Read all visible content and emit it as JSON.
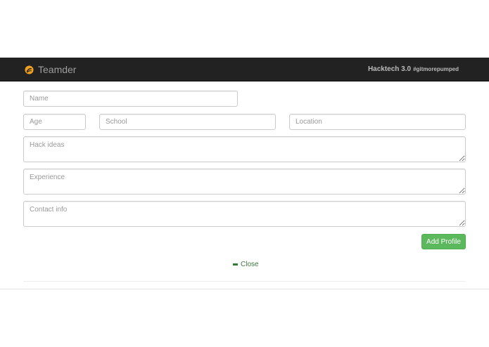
{
  "navbar": {
    "brand_label": "Teamder",
    "brand_icon": "flame-logo-icon",
    "event_title": "Hacktech 3.0",
    "event_hashtag": "#gitmorepumped"
  },
  "form": {
    "name_placeholder": "Name",
    "age_placeholder": "Age",
    "school_placeholder": "School",
    "location_placeholder": "Location",
    "hack_ideas_placeholder": "Hack ideas",
    "experience_placeholder": "Experience",
    "contact_placeholder": "Contact info",
    "submit_label": "Add Profile",
    "close_label": "Close",
    "close_icon": "minus-icon"
  },
  "colors": {
    "navbar_bg": "#222222",
    "brand_icon": "#f0a020",
    "submit_button": "#5cb85c",
    "close_link": "#3c763d"
  }
}
